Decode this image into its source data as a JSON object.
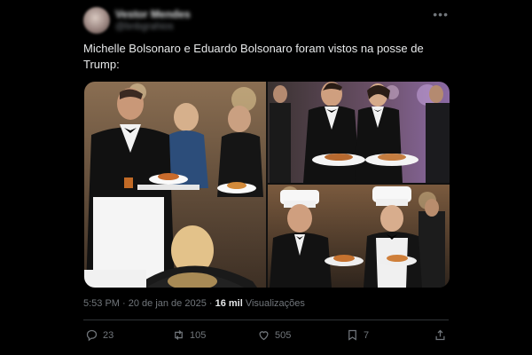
{
  "post": {
    "author_name": "Vestor Mendes",
    "author_handle": "@bnbgrahios",
    "more_icon": "more-horizontal-icon",
    "text": "Michelle Bolsonaro e Eduardo Bolsonaro foram vistos na posse de Trump:",
    "timestamp": "5:53 PM · 20 de jan de 2025 · ",
    "views_count": "16 mil",
    "views_label": " Visualizações"
  },
  "actions": {
    "reply_count": "23",
    "retweet_count": "105",
    "like_count": "505",
    "bookmark_count": "7"
  },
  "icons": {
    "reply": "reply-icon",
    "retweet": "retweet-icon",
    "like": "heart-icon",
    "bookmark": "bookmark-icon",
    "share": "share-icon"
  },
  "colors": {
    "background": "#000000",
    "text": "#e7e9ea",
    "muted": "#71767b",
    "divider": "#2f3336"
  }
}
